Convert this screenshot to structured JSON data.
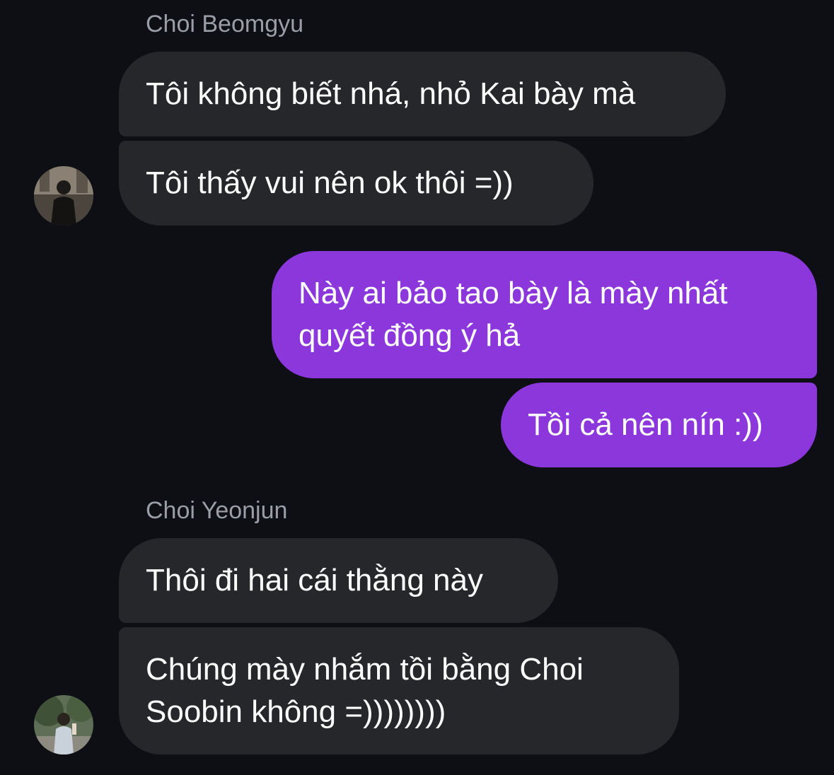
{
  "messages": [
    {
      "sender": "Choi Beomgyu",
      "direction": "incoming",
      "bubbles": [
        "Tôi không biết nhá, nhỏ Kai bày mà",
        "Tôi thấy vui nên ok thôi =))"
      ]
    },
    {
      "sender": "",
      "direction": "outgoing",
      "bubbles": [
        "Này ai bảo tao bày là mày nhất\nquyết đồng ý hả",
        "Tồi cả nên nín :))"
      ]
    },
    {
      "sender": "Choi Yeonjun",
      "direction": "incoming",
      "bubbles": [
        "Thôi đi hai cái thằng này",
        "Chúng mày nhắm tồi bằng Choi\nSoobin không =))))))))"
      ]
    }
  ],
  "colors": {
    "background": "#0d0f14",
    "incoming_bubble": "#25272b",
    "outgoing_bubble": "#8b37dc",
    "sender_name": "#9a9ea6",
    "text": "#ffffff"
  },
  "icons": {
    "avatar_1": "avatar-photo-beomgyu",
    "avatar_2": "avatar-photo-yeonjun"
  }
}
